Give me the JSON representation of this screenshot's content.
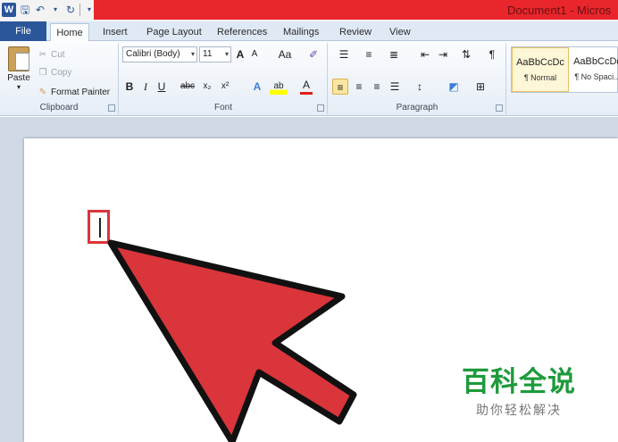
{
  "window": {
    "title": "Document1 - Micros",
    "app_icon": "W",
    "accent": "#e8262b"
  },
  "tabs": [
    "File",
    "Home",
    "Insert",
    "Page Layout",
    "References",
    "Mailings",
    "Review",
    "View"
  ],
  "clipboard": {
    "paste": "Paste",
    "cut": "Cut",
    "copy": "Copy",
    "format_painter": "Format Painter",
    "label": "Clipboard"
  },
  "font": {
    "name": "Calibri (Body)",
    "size": "11",
    "label": "Font",
    "bold": "B",
    "italic": "I",
    "underline": "U",
    "strike": "abc",
    "subscript": "x₂",
    "superscript": "x²",
    "grow": "A",
    "shrink": "A",
    "case": "Aa",
    "font_color": "A",
    "highlight": "ab"
  },
  "paragraph": {
    "label": "Paragraph",
    "pilcrow": "¶"
  },
  "styles": [
    {
      "sample": "AaBbCcDc",
      "name": "¶ Normal"
    },
    {
      "sample": "AaBbCcDc",
      "name": "¶ No Spaci..."
    }
  ],
  "watermark": {
    "title": "百科全说",
    "subtitle": "助你轻松解决",
    "color": "#1e9a3c"
  },
  "annotation": {
    "arrow_color": "#d9353b"
  }
}
